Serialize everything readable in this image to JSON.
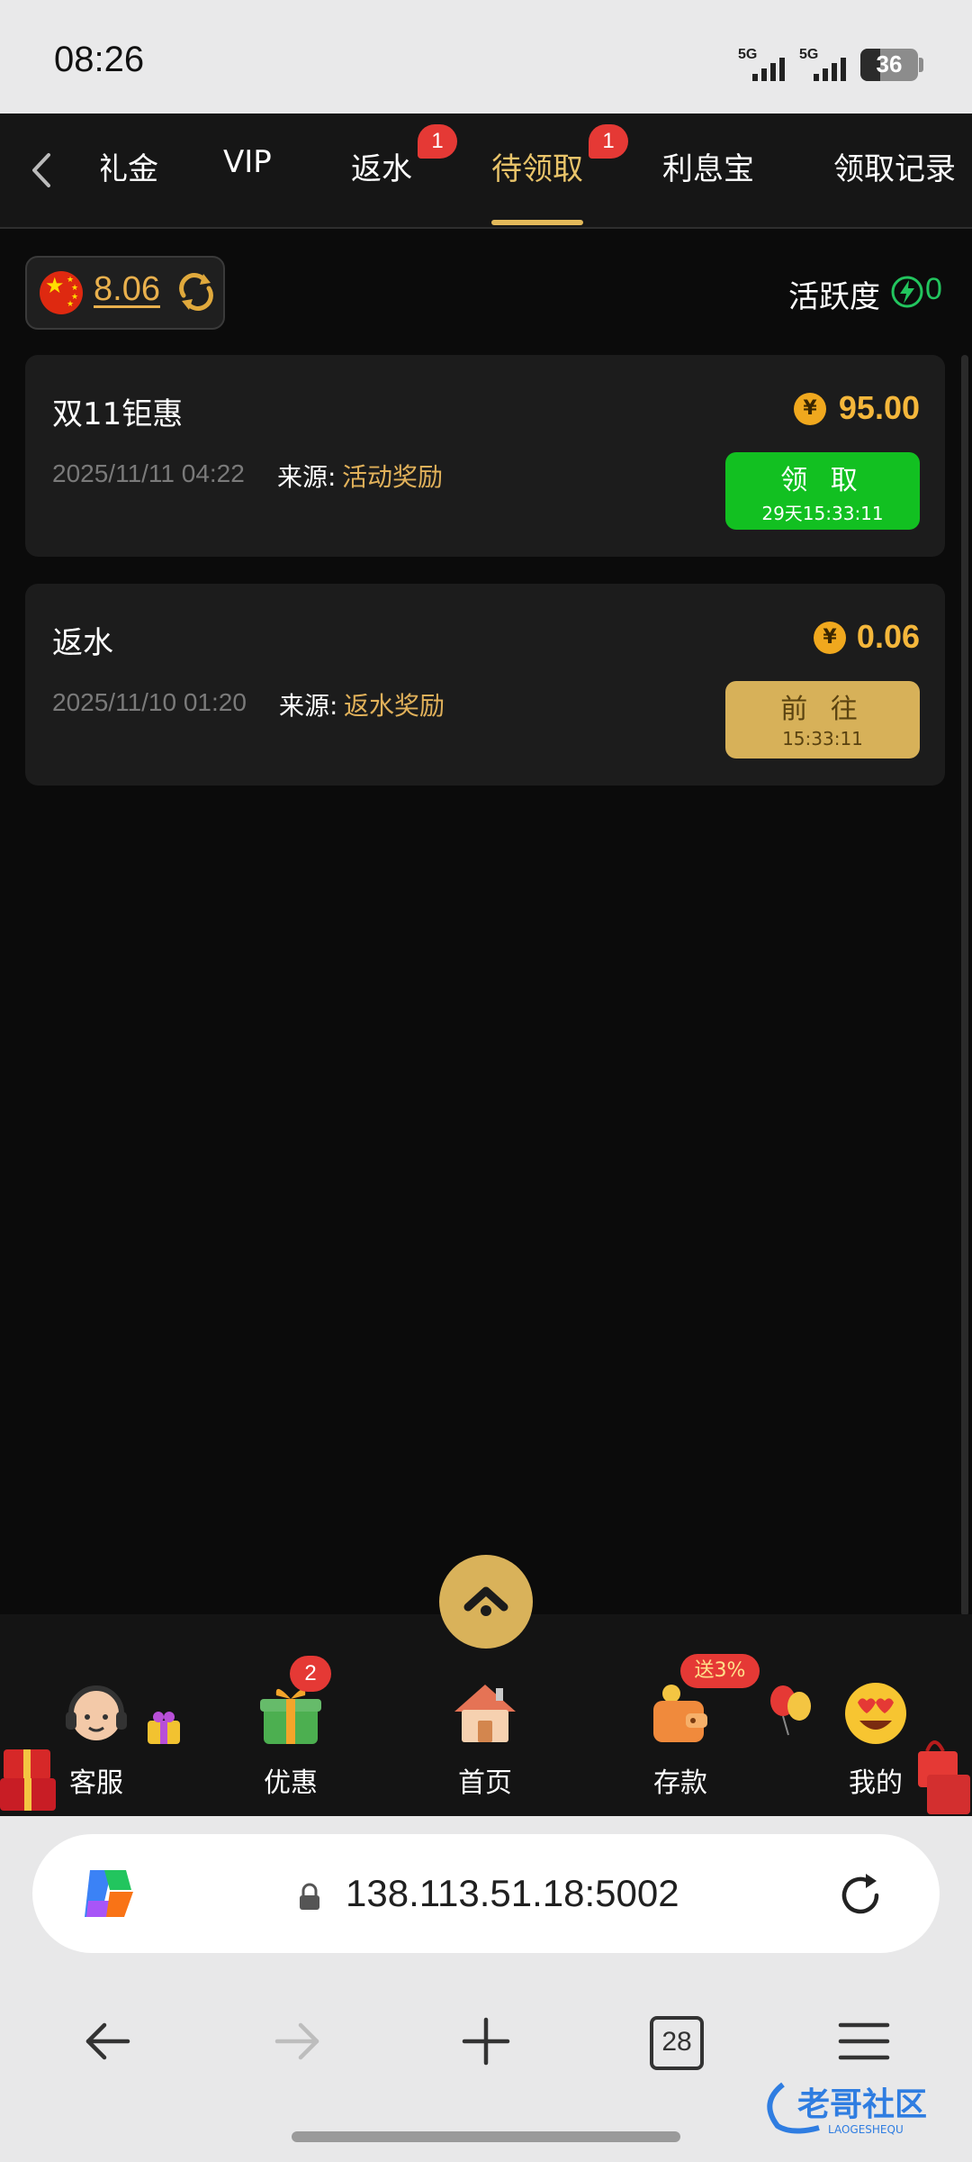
{
  "status_bar": {
    "time": "08:26",
    "signal1": "5G",
    "signal2": "5G",
    "battery": "36"
  },
  "tabs": [
    {
      "label": "礼金",
      "visible_text": "礼金"
    },
    {
      "label": "VIP"
    },
    {
      "label": "返水",
      "badge": "1"
    },
    {
      "label": "待领取",
      "badge": "1",
      "active": true
    },
    {
      "label": "利息宝"
    },
    {
      "label": "领取记录"
    }
  ],
  "balance": {
    "value": "8.06"
  },
  "activity": {
    "label": "活跃度",
    "value": "0"
  },
  "cards": [
    {
      "title": "双11钜惠",
      "date": "2025/11/11 04:22",
      "source_label": "来源:",
      "source_value": "活动奖励",
      "coin_symbol": "¥",
      "amount": "95.00",
      "button_label": "领 取",
      "button_sub": "29天15:33:11",
      "button_color": "#12c021"
    },
    {
      "title": "返水",
      "date": "2025/11/10 01:20",
      "source_label": "来源:",
      "source_value": "返水奖励",
      "coin_symbol": "¥",
      "amount": "0.06",
      "button_label": "前 往",
      "button_sub": "15:33:11",
      "button_color": "#d7b159"
    }
  ],
  "bottom_nav": [
    {
      "label": "客服",
      "icon": "headset-agent-icon"
    },
    {
      "label": "优惠",
      "icon": "gift-box-icon",
      "badge": "2"
    },
    {
      "label": "首页",
      "icon": "house-icon"
    },
    {
      "label": "存款",
      "icon": "wallet-icon",
      "badge": "送3%"
    },
    {
      "label": "我的",
      "icon": "heart-eyes-emoji-icon"
    }
  ],
  "browser": {
    "url": "138.113.51.18:5002",
    "tab_count": "28"
  },
  "watermark": {
    "text": "老哥社区",
    "sub": "LAOGESHEQU"
  },
  "colors": {
    "accent_gold": "#e3b95a",
    "claim_green": "#12c021",
    "badge_red": "#e53935",
    "activity_green": "#22c55e"
  }
}
